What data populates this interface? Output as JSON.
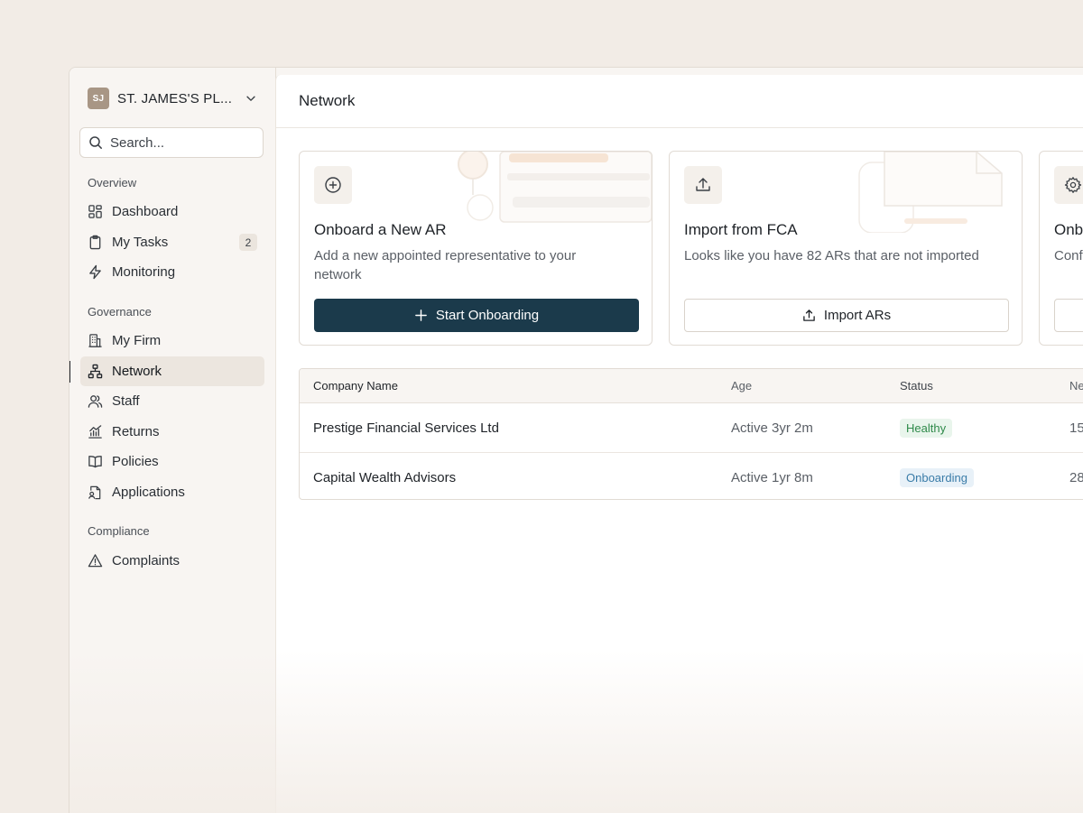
{
  "org": {
    "initials": "SJ",
    "name": "ST. JAMES'S PL..."
  },
  "search": {
    "placeholder": "Search..."
  },
  "sidebar": {
    "sections": [
      {
        "label": "Overview"
      },
      {
        "label": "Governance"
      },
      {
        "label": "Compliance"
      }
    ],
    "items": [
      {
        "label": "Dashboard",
        "icon": "dashboard-icon"
      },
      {
        "label": "My Tasks",
        "icon": "clipboard-icon",
        "badge": "2"
      },
      {
        "label": "Monitoring",
        "icon": "lightning-icon"
      },
      {
        "label": "My Firm",
        "icon": "building-icon"
      },
      {
        "label": "Network",
        "icon": "network-icon",
        "active": true
      },
      {
        "label": "Staff",
        "icon": "users-icon"
      },
      {
        "label": "Returns",
        "icon": "chart-icon"
      },
      {
        "label": "Policies",
        "icon": "book-icon"
      },
      {
        "label": "Applications",
        "icon": "file-user-icon"
      },
      {
        "label": "Complaints",
        "icon": "warning-icon"
      }
    ]
  },
  "header": {
    "title": "Network"
  },
  "cards": [
    {
      "title": "Onboard a New AR",
      "description": "Add a new appointed representative to your network",
      "button": "Start Onboarding",
      "icon": "plus-circle-icon"
    },
    {
      "title": "Import from FCA",
      "description": "Looks like you have 82 ARs that are not imported",
      "button": "Import ARs",
      "icon": "upload-icon"
    },
    {
      "title": "Onb",
      "description": "Conf",
      "icon": "gear-icon"
    }
  ],
  "table": {
    "headers": [
      "Company Name",
      "Age",
      "Status",
      "Ne"
    ],
    "rows": [
      {
        "name": "Prestige Financial Services Ltd",
        "age": "Active 3yr 2m",
        "status": "Healthy",
        "network": "15"
      },
      {
        "name": "Capital Wealth Advisors",
        "age": "Active 1yr 8m",
        "status": "Onboarding",
        "network": "28"
      }
    ]
  },
  "colors": {
    "primary": "#1b3a4b",
    "healthy_text": "#2f8a4a",
    "healthy_bg": "#e9f5ec",
    "onboarding_text": "#3a7ca8",
    "onboarding_bg": "#e8f1f8"
  }
}
